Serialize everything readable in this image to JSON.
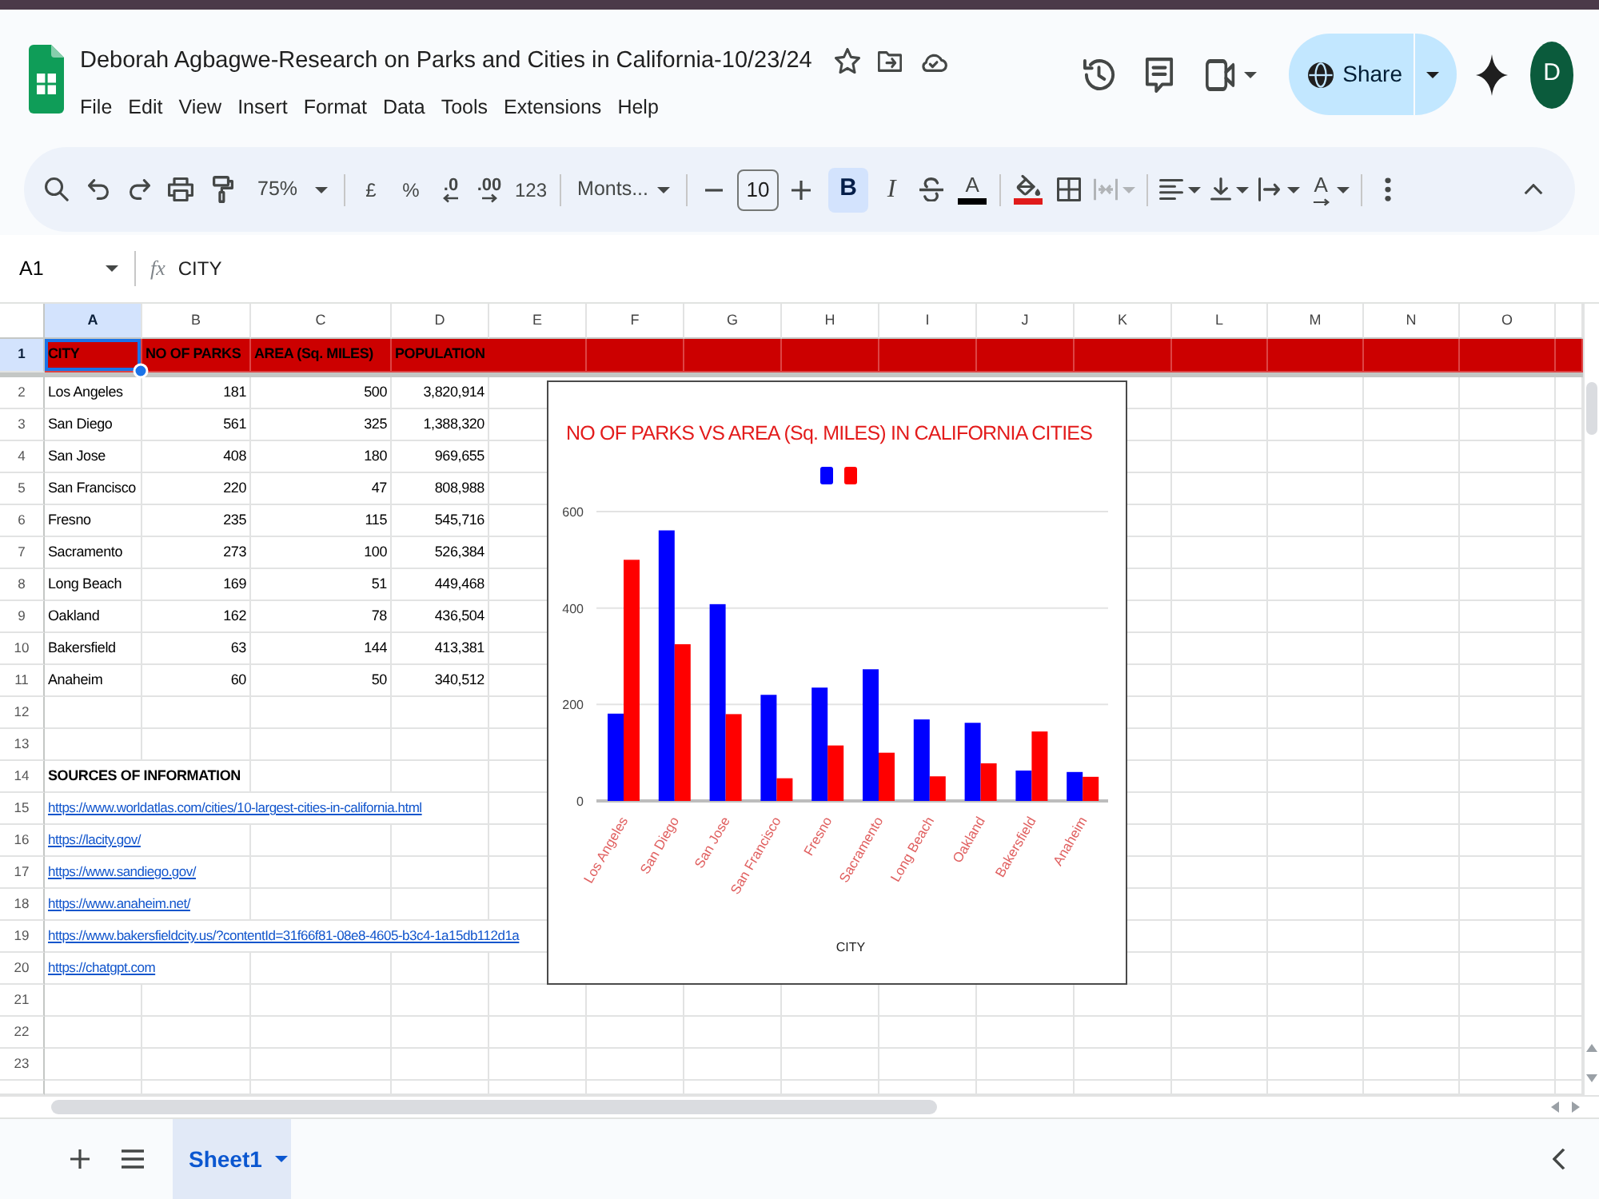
{
  "window": {
    "title": "Deborah Agbagwe-Research on Parks and Cities in California-10/23/24"
  },
  "menu": [
    "File",
    "Edit",
    "View",
    "Insert",
    "Format",
    "Data",
    "Tools",
    "Extensions",
    "Help"
  ],
  "header": {
    "share": "Share",
    "avatar": "D"
  },
  "toolbar": {
    "zoom": "75%",
    "currency": "£",
    "percent": "%",
    "decimal_decrease": ".0",
    "decimal_increase": ".00",
    "number_format": "123",
    "font": "Monts...",
    "font_size": "10",
    "bold": {
      "label": "B",
      "selected": true
    },
    "italic": {
      "label": "I",
      "selected": false
    },
    "text_color": {
      "label": "A",
      "color": "#000000"
    },
    "fill_color": {
      "color": "#e01b1b"
    },
    "merge": {
      "disabled": true
    },
    "text_rotation": {
      "label": "A"
    }
  },
  "formula_bar": {
    "cell_ref": "A1",
    "fx": "fx",
    "value": "CITY"
  },
  "columns": [
    {
      "label": "A",
      "selected": true
    },
    {
      "label": "B",
      "selected": false
    },
    {
      "label": "C",
      "selected": false
    },
    {
      "label": "D",
      "selected": false
    },
    {
      "label": "E",
      "selected": false
    },
    {
      "label": "F",
      "selected": false
    },
    {
      "label": "G",
      "selected": false
    },
    {
      "label": "H",
      "selected": false
    },
    {
      "label": "I",
      "selected": false
    },
    {
      "label": "J",
      "selected": false
    },
    {
      "label": "K",
      "selected": false
    },
    {
      "label": "L",
      "selected": false
    },
    {
      "label": "M",
      "selected": false
    },
    {
      "label": "N",
      "selected": false
    },
    {
      "label": "O",
      "selected": false
    }
  ],
  "rows": [
    {
      "number": "1",
      "selected": true,
      "kind": "header",
      "cells": [
        "CITY",
        "NO OF PARKS",
        "AREA (Sq. MILES)",
        "POPULATION"
      ]
    },
    {
      "number": "2",
      "selected": false,
      "kind": "data",
      "cells": [
        "Los Angeles",
        "181",
        "500",
        "3,820,914"
      ]
    },
    {
      "number": "3",
      "selected": false,
      "kind": "data",
      "cells": [
        "San Diego",
        "561",
        "325",
        "1,388,320"
      ]
    },
    {
      "number": "4",
      "selected": false,
      "kind": "data",
      "cells": [
        "San Jose",
        "408",
        "180",
        "969,655"
      ]
    },
    {
      "number": "5",
      "selected": false,
      "kind": "data",
      "cells": [
        "San Francisco",
        "220",
        "47",
        "808,988"
      ]
    },
    {
      "number": "6",
      "selected": false,
      "kind": "data",
      "cells": [
        "Fresno",
        "235",
        "115",
        "545,716"
      ]
    },
    {
      "number": "7",
      "selected": false,
      "kind": "data",
      "cells": [
        "Sacramento",
        "273",
        "100",
        "526,384"
      ]
    },
    {
      "number": "8",
      "selected": false,
      "kind": "data",
      "cells": [
        "Long Beach",
        "169",
        "51",
        "449,468"
      ]
    },
    {
      "number": "9",
      "selected": false,
      "kind": "data",
      "cells": [
        "Oakland",
        "162",
        "78",
        "436,504"
      ]
    },
    {
      "number": "10",
      "selected": false,
      "kind": "data",
      "cells": [
        "Bakersfield",
        "63",
        "144",
        "413,381"
      ]
    },
    {
      "number": "11",
      "selected": false,
      "kind": "data",
      "cells": [
        "Anaheim",
        "60",
        "50",
        "340,512"
      ]
    },
    {
      "number": "12",
      "selected": false,
      "kind": "empty"
    },
    {
      "number": "13",
      "selected": false,
      "kind": "empty"
    },
    {
      "number": "14",
      "selected": false,
      "kind": "heading",
      "cells": [
        "SOURCES OF INFORMATION"
      ]
    },
    {
      "number": "15",
      "selected": false,
      "kind": "link",
      "cells": [
        "https://www.worldatlas.com/cities/10-largest-cities-in-california.html"
      ]
    },
    {
      "number": "16",
      "selected": false,
      "kind": "link",
      "cells": [
        "https://lacity.gov/"
      ]
    },
    {
      "number": "17",
      "selected": false,
      "kind": "link",
      "cells": [
        "https://www.sandiego.gov/"
      ]
    },
    {
      "number": "18",
      "selected": false,
      "kind": "link",
      "cells": [
        "https://www.anaheim.net/"
      ]
    },
    {
      "number": "19",
      "selected": false,
      "kind": "link",
      "cells": [
        "https://www.bakersfieldcity.us/?contentId=31f66f81-08e8-4605-b3c4-1a15db112d1a"
      ]
    },
    {
      "number": "20",
      "selected": false,
      "kind": "link",
      "cells": [
        "https://chatgpt.com"
      ]
    },
    {
      "number": "21",
      "selected": false,
      "kind": "empty"
    },
    {
      "number": "22",
      "selected": false,
      "kind": "empty"
    },
    {
      "number": "23",
      "selected": false,
      "kind": "empty"
    }
  ],
  "chart": {
    "chart_data": {
      "type": "bar",
      "title": "NO OF PARKS VS AREA (Sq. MILES) IN CALIFORNIA CITIES",
      "xlabel": "CITY",
      "categories": [
        "Los Angeles",
        "San Diego",
        "San Jose",
        "San Francisco",
        "Fresno",
        "Sacramento",
        "Long Beach",
        "Oakland",
        "Bakersfield",
        "Anaheim"
      ],
      "series": [
        {
          "color": "#0000ff",
          "values": [
            181,
            561,
            408,
            220,
            235,
            273,
            169,
            162,
            63,
            60
          ]
        },
        {
          "color": "#ff0000",
          "values": [
            500,
            325,
            180,
            47,
            115,
            100,
            51,
            78,
            144,
            50
          ]
        }
      ],
      "ylim": [
        0,
        600
      ],
      "yticks": [
        0,
        200,
        400,
        600
      ]
    }
  },
  "sheets": [
    {
      "label": "Sheet1",
      "selected": true
    }
  ]
}
